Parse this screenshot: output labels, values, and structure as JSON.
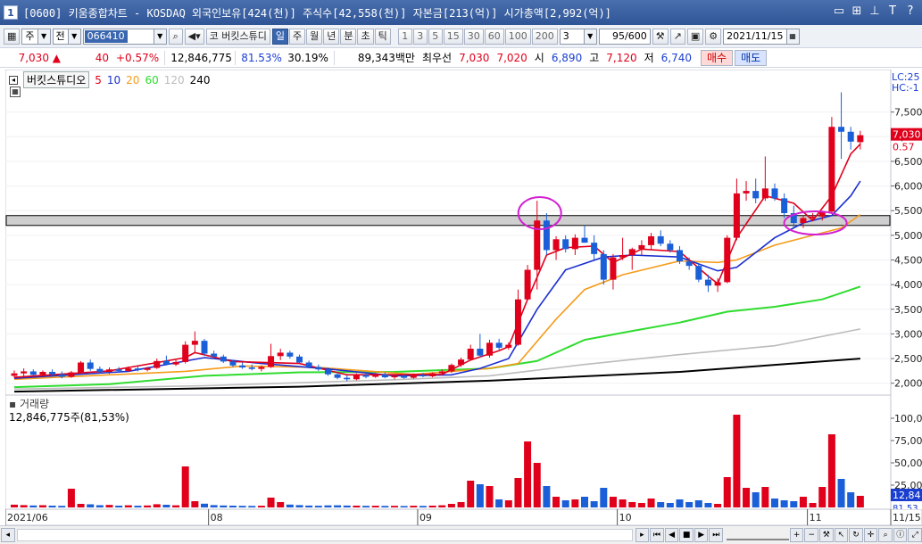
{
  "titlebar": {
    "num": "1",
    "text": "[0600] 키움종합차트 - KOSDAQ 외국인보유[424(천)] 주식수[42,558(천)] 자본금[213(억)] 시가총액[2,992(억)]",
    "icons": [
      "window-icon",
      "grid-icon",
      "pin-icon",
      "T",
      "?"
    ]
  },
  "toolbar": {
    "market": "주",
    "period_type": "전",
    "code": "066410",
    "stock_name": "코 버킷스튜디",
    "timeframes": [
      "일",
      "주",
      "월",
      "년",
      "분",
      "초",
      "틱"
    ],
    "active_timeframe": "일",
    "minute_options": [
      "1",
      "3",
      "5",
      "15",
      "30",
      "60",
      "100",
      "200"
    ],
    "interval": "3",
    "count": "95/600",
    "date": "2021/11/15"
  },
  "quote": {
    "price": "7,030",
    "change": "40",
    "rate": "+0.57%",
    "volume": "12,846,775",
    "vol_ratio": "81.53%",
    "turnover": "30.19%",
    "amount": "89,343백만",
    "best_label": "최우선",
    "best_ask": "7,030",
    "best_bid": "7,020",
    "open_label": "시",
    "open": "6,890",
    "high_label": "고",
    "high": "7,120",
    "low_label": "저",
    "low": "6,740",
    "buy": "매수",
    "sell": "매도"
  },
  "legend": {
    "title": "버킷스튜디오",
    "periods": [
      "5",
      "10",
      "20",
      "60",
      "120",
      "240"
    ]
  },
  "volume_legend": {
    "title": "거래량",
    "value": "12,846,775주(81,53%)"
  },
  "right_labels": {
    "lc": "LC:25",
    "hc": "HC:-1",
    "price_tag": "7,030",
    "pct_tag": "0.57",
    "vol_tag": "12,84",
    "vol_pct": "81.53"
  },
  "colors": {
    "up": "#e0001b",
    "down": "#1a5fd8",
    "ma5": "#e0001b",
    "ma10": "#1a2fd0",
    "ma20": "#f59b1a",
    "ma60": "#2fdc2f",
    "ma120": "#bcbcbc",
    "ma240": "#000000",
    "highlight": "#d21fd2"
  },
  "chart_data": {
    "type": "candlestick",
    "y_ticks": [
      "7,500",
      "7,000",
      "6,500",
      "6,000",
      "5,500",
      "5,000",
      "4,500",
      "4,000",
      "3,500",
      "3,000",
      "2,500",
      "2,000"
    ],
    "ylim": [
      1850,
      8000
    ],
    "vol_ticks": [
      "100,0",
      "75,00",
      "50,00",
      "25,00"
    ],
    "x_labels": [
      {
        "i": 0,
        "label": "2021/06"
      },
      {
        "i": 21,
        "label": "08"
      },
      {
        "i": 43,
        "label": "09"
      },
      {
        "i": 64,
        "label": "10"
      },
      {
        "i": 84,
        "label": "11"
      },
      {
        "i": 100,
        "label": "11/15"
      }
    ],
    "support_band": [
      5200,
      5400
    ],
    "candles": [
      {
        "o": 2150,
        "h": 2260,
        "l": 2110,
        "c": 2200,
        "v": 3.1
      },
      {
        "o": 2200,
        "h": 2300,
        "l": 2140,
        "c": 2240,
        "v": 2.6
      },
      {
        "o": 2240,
        "h": 2280,
        "l": 2150,
        "c": 2170,
        "v": 2.2
      },
      {
        "o": 2170,
        "h": 2260,
        "l": 2130,
        "c": 2230,
        "v": 2.5
      },
      {
        "o": 2230,
        "h": 2280,
        "l": 2150,
        "c": 2180,
        "v": 2.0
      },
      {
        "o": 2180,
        "h": 2240,
        "l": 2100,
        "c": 2130,
        "v": 1.8
      },
      {
        "o": 2130,
        "h": 2250,
        "l": 2110,
        "c": 2220,
        "v": 21.0
      },
      {
        "o": 2220,
        "h": 2450,
        "l": 2200,
        "c": 2420,
        "v": 4.0
      },
      {
        "o": 2420,
        "h": 2480,
        "l": 2250,
        "c": 2290,
        "v": 3.5
      },
      {
        "o": 2290,
        "h": 2340,
        "l": 2200,
        "c": 2230,
        "v": 2.5
      },
      {
        "o": 2230,
        "h": 2320,
        "l": 2190,
        "c": 2280,
        "v": 2.8
      },
      {
        "o": 2280,
        "h": 2330,
        "l": 2220,
        "c": 2250,
        "v": 2.0
      },
      {
        "o": 2250,
        "h": 2340,
        "l": 2230,
        "c": 2300,
        "v": 2.4
      },
      {
        "o": 2300,
        "h": 2350,
        "l": 2240,
        "c": 2270,
        "v": 1.9
      },
      {
        "o": 2270,
        "h": 2330,
        "l": 2240,
        "c": 2310,
        "v": 2.2
      },
      {
        "o": 2310,
        "h": 2500,
        "l": 2290,
        "c": 2450,
        "v": 3.6
      },
      {
        "o": 2450,
        "h": 2560,
        "l": 2360,
        "c": 2380,
        "v": 3.0
      },
      {
        "o": 2380,
        "h": 2470,
        "l": 2350,
        "c": 2430,
        "v": 2.4
      },
      {
        "o": 2430,
        "h": 2850,
        "l": 2400,
        "c": 2780,
        "v": 46.0
      },
      {
        "o": 2780,
        "h": 3050,
        "l": 2620,
        "c": 2860,
        "v": 7.0
      },
      {
        "o": 2860,
        "h": 2900,
        "l": 2560,
        "c": 2600,
        "v": 4.2
      },
      {
        "o": 2600,
        "h": 2660,
        "l": 2500,
        "c": 2540,
        "v": 2.6
      },
      {
        "o": 2540,
        "h": 2580,
        "l": 2410,
        "c": 2440,
        "v": 2.2
      },
      {
        "o": 2440,
        "h": 2470,
        "l": 2330,
        "c": 2360,
        "v": 2.0
      },
      {
        "o": 2360,
        "h": 2420,
        "l": 2290,
        "c": 2320,
        "v": 1.8
      },
      {
        "o": 2320,
        "h": 2380,
        "l": 2260,
        "c": 2290,
        "v": 1.7
      },
      {
        "o": 2290,
        "h": 2360,
        "l": 2240,
        "c": 2330,
        "v": 1.9
      },
      {
        "o": 2330,
        "h": 2800,
        "l": 2310,
        "c": 2550,
        "v": 11.0
      },
      {
        "o": 2550,
        "h": 2700,
        "l": 2470,
        "c": 2620,
        "v": 6.0
      },
      {
        "o": 2620,
        "h": 2660,
        "l": 2500,
        "c": 2540,
        "v": 3.2
      },
      {
        "o": 2540,
        "h": 2580,
        "l": 2390,
        "c": 2420,
        "v": 2.6
      },
      {
        "o": 2420,
        "h": 2460,
        "l": 2300,
        "c": 2330,
        "v": 2.1
      },
      {
        "o": 2330,
        "h": 2380,
        "l": 2250,
        "c": 2280,
        "v": 1.9
      },
      {
        "o": 2280,
        "h": 2320,
        "l": 2150,
        "c": 2180,
        "v": 2.3
      },
      {
        "o": 2180,
        "h": 2220,
        "l": 2080,
        "c": 2110,
        "v": 2.4
      },
      {
        "o": 2110,
        "h": 2160,
        "l": 2040,
        "c": 2080,
        "v": 2.1
      },
      {
        "o": 2080,
        "h": 2200,
        "l": 2060,
        "c": 2170,
        "v": 2.0
      },
      {
        "o": 2170,
        "h": 2230,
        "l": 2100,
        "c": 2130,
        "v": 1.8
      },
      {
        "o": 2130,
        "h": 2210,
        "l": 2110,
        "c": 2180,
        "v": 1.9
      },
      {
        "o": 2180,
        "h": 2220,
        "l": 2100,
        "c": 2120,
        "v": 1.7
      },
      {
        "o": 2120,
        "h": 2180,
        "l": 2080,
        "c": 2150,
        "v": 1.8
      },
      {
        "o": 2150,
        "h": 2190,
        "l": 2090,
        "c": 2110,
        "v": 1.6
      },
      {
        "o": 2110,
        "h": 2200,
        "l": 2090,
        "c": 2170,
        "v": 1.9
      },
      {
        "o": 2170,
        "h": 2210,
        "l": 2120,
        "c": 2140,
        "v": 1.7
      },
      {
        "o": 2140,
        "h": 2220,
        "l": 2120,
        "c": 2200,
        "v": 2.0
      },
      {
        "o": 2200,
        "h": 2280,
        "l": 2170,
        "c": 2240,
        "v": 2.4
      },
      {
        "o": 2240,
        "h": 2400,
        "l": 2210,
        "c": 2370,
        "v": 4.0
      },
      {
        "o": 2370,
        "h": 2520,
        "l": 2330,
        "c": 2480,
        "v": 6.0
      },
      {
        "o": 2480,
        "h": 2780,
        "l": 2460,
        "c": 2700,
        "v": 30.0
      },
      {
        "o": 2700,
        "h": 3000,
        "l": 2520,
        "c": 2560,
        "v": 26.0
      },
      {
        "o": 2560,
        "h": 2880,
        "l": 2520,
        "c": 2820,
        "v": 24.0
      },
      {
        "o": 2820,
        "h": 2900,
        "l": 2680,
        "c": 2720,
        "v": 9.0
      },
      {
        "o": 2720,
        "h": 2830,
        "l": 2680,
        "c": 2780,
        "v": 8.0
      },
      {
        "o": 2780,
        "h": 3900,
        "l": 2760,
        "c": 3700,
        "v": 33.0
      },
      {
        "o": 3700,
        "h": 4400,
        "l": 3680,
        "c": 4300,
        "v": 74.0
      },
      {
        "o": 4300,
        "h": 5700,
        "l": 3900,
        "c": 5300,
        "v": 50.0
      },
      {
        "o": 5300,
        "h": 5450,
        "l": 4600,
        "c": 4700,
        "v": 24.0
      },
      {
        "o": 4700,
        "h": 4980,
        "l": 4500,
        "c": 4920,
        "v": 12.0
      },
      {
        "o": 4920,
        "h": 5000,
        "l": 4650,
        "c": 4720,
        "v": 8.0
      },
      {
        "o": 4720,
        "h": 5020,
        "l": 4600,
        "c": 4950,
        "v": 9.0
      },
      {
        "o": 4950,
        "h": 5200,
        "l": 4850,
        "c": 4850,
        "v": 12.0
      },
      {
        "o": 4850,
        "h": 5000,
        "l": 4500,
        "c": 4620,
        "v": 7.0
      },
      {
        "o": 4620,
        "h": 4700,
        "l": 4000,
        "c": 4100,
        "v": 22.0
      },
      {
        "o": 4100,
        "h": 4620,
        "l": 3900,
        "c": 4550,
        "v": 12.0
      },
      {
        "o": 4550,
        "h": 4950,
        "l": 4500,
        "c": 4600,
        "v": 9.0
      },
      {
        "o": 4600,
        "h": 4750,
        "l": 4300,
        "c": 4720,
        "v": 6.0
      },
      {
        "o": 4720,
        "h": 4900,
        "l": 4600,
        "c": 4800,
        "v": 5.0
      },
      {
        "o": 4800,
        "h": 5050,
        "l": 4700,
        "c": 4980,
        "v": 10.0
      },
      {
        "o": 4980,
        "h": 5100,
        "l": 4780,
        "c": 4830,
        "v": 6.0
      },
      {
        "o": 4830,
        "h": 4900,
        "l": 4650,
        "c": 4700,
        "v": 5.0
      },
      {
        "o": 4700,
        "h": 4780,
        "l": 4420,
        "c": 4470,
        "v": 9.0
      },
      {
        "o": 4470,
        "h": 4550,
        "l": 4300,
        "c": 4380,
        "v": 6.0
      },
      {
        "o": 4380,
        "h": 4430,
        "l": 4050,
        "c": 4100,
        "v": 8.0
      },
      {
        "o": 4100,
        "h": 4200,
        "l": 3850,
        "c": 3980,
        "v": 5.0
      },
      {
        "o": 3980,
        "h": 4130,
        "l": 3850,
        "c": 4050,
        "v": 4.0
      },
      {
        "o": 4050,
        "h": 5000,
        "l": 4030,
        "c": 4950,
        "v": 34.0
      },
      {
        "o": 4950,
        "h": 6150,
        "l": 4900,
        "c": 5850,
        "v": 104.0
      },
      {
        "o": 5850,
        "h": 6100,
        "l": 5700,
        "c": 5900,
        "v": 22.0
      },
      {
        "o": 5900,
        "h": 6150,
        "l": 5650,
        "c": 5750,
        "v": 17.0
      },
      {
        "o": 5750,
        "h": 6600,
        "l": 5700,
        "c": 5950,
        "v": 23.0
      },
      {
        "o": 5950,
        "h": 6050,
        "l": 5700,
        "c": 5750,
        "v": 10.0
      },
      {
        "o": 5750,
        "h": 5850,
        "l": 5350,
        "c": 5450,
        "v": 8.0
      },
      {
        "o": 5450,
        "h": 5600,
        "l": 5150,
        "c": 5250,
        "v": 7.0
      },
      {
        "o": 5250,
        "h": 5400,
        "l": 5150,
        "c": 5350,
        "v": 12.0
      },
      {
        "o": 5350,
        "h": 5450,
        "l": 5300,
        "c": 5380,
        "v": 5.0
      },
      {
        "o": 5380,
        "h": 5500,
        "l": 5300,
        "c": 5480,
        "v": 23.0
      },
      {
        "o": 5480,
        "h": 7400,
        "l": 5450,
        "c": 7200,
        "v": 82.0
      },
      {
        "o": 7200,
        "h": 7900,
        "l": 6550,
        "c": 7100,
        "v": 32.0
      },
      {
        "o": 7100,
        "h": 7200,
        "l": 6740,
        "c": 6900,
        "v": 17.0
      },
      {
        "o": 6890,
        "h": 7120,
        "l": 6740,
        "c": 7030,
        "v": 13.0
      }
    ],
    "ma": {
      "ma5": [
        [
          0,
          2120
        ],
        [
          10,
          2250
        ],
        [
          18,
          2520
        ],
        [
          19,
          2620
        ],
        [
          23,
          2440
        ],
        [
          30,
          2400
        ],
        [
          35,
          2170
        ],
        [
          45,
          2180
        ],
        [
          48,
          2470
        ],
        [
          51,
          2660
        ],
        [
          52,
          2740
        ],
        [
          54,
          3700
        ],
        [
          56,
          4600
        ],
        [
          58,
          4750
        ],
        [
          61,
          4780
        ],
        [
          63,
          4450
        ],
        [
          66,
          4720
        ],
        [
          70,
          4670
        ],
        [
          73,
          4170
        ],
        [
          74,
          4020
        ],
        [
          76,
          4950
        ],
        [
          79,
          5800
        ],
        [
          82,
          5650
        ],
        [
          84,
          5300
        ],
        [
          86,
          5800
        ],
        [
          88,
          6650
        ],
        [
          89,
          6850
        ]
      ],
      "ma10": [
        [
          0,
          2100
        ],
        [
          12,
          2240
        ],
        [
          20,
          2520
        ],
        [
          26,
          2400
        ],
        [
          33,
          2290
        ],
        [
          40,
          2150
        ],
        [
          46,
          2170
        ],
        [
          49,
          2300
        ],
        [
          52,
          2500
        ],
        [
          55,
          3500
        ],
        [
          58,
          4300
        ],
        [
          62,
          4560
        ],
        [
          65,
          4600
        ],
        [
          70,
          4560
        ],
        [
          74,
          4280
        ],
        [
          76,
          4350
        ],
        [
          80,
          4950
        ],
        [
          83,
          5250
        ],
        [
          86,
          5400
        ],
        [
          88,
          5800
        ],
        [
          89,
          6100
        ]
      ],
      "ma20": [
        [
          0,
          2080
        ],
        [
          18,
          2240
        ],
        [
          24,
          2350
        ],
        [
          32,
          2320
        ],
        [
          42,
          2180
        ],
        [
          50,
          2300
        ],
        [
          53,
          2400
        ],
        [
          57,
          3300
        ],
        [
          60,
          3900
        ],
        [
          64,
          4200
        ],
        [
          70,
          4480
        ],
        [
          74,
          4450
        ],
        [
          76,
          4500
        ],
        [
          80,
          4800
        ],
        [
          84,
          5000
        ],
        [
          87,
          5150
        ],
        [
          89,
          5420
        ]
      ],
      "ma60": [
        [
          0,
          1920
        ],
        [
          10,
          1980
        ],
        [
          20,
          2150
        ],
        [
          30,
          2220
        ],
        [
          40,
          2230
        ],
        [
          50,
          2300
        ],
        [
          55,
          2450
        ],
        [
          60,
          2880
        ],
        [
          65,
          3060
        ],
        [
          70,
          3230
        ],
        [
          75,
          3450
        ],
        [
          80,
          3550
        ],
        [
          85,
          3700
        ],
        [
          89,
          3960
        ]
      ],
      "ma120": [
        [
          0,
          1880
        ],
        [
          20,
          1950
        ],
        [
          40,
          2070
        ],
        [
          50,
          2150
        ],
        [
          60,
          2380
        ],
        [
          70,
          2580
        ],
        [
          80,
          2760
        ],
        [
          89,
          3100
        ]
      ],
      "ma240": [
        [
          0,
          1830
        ],
        [
          30,
          1930
        ],
        [
          50,
          2050
        ],
        [
          70,
          2230
        ],
        [
          89,
          2500
        ]
      ]
    },
    "highlights": [
      {
        "i": 55,
        "price": 5450
      },
      {
        "i": 84,
        "price": 5250
      }
    ]
  }
}
